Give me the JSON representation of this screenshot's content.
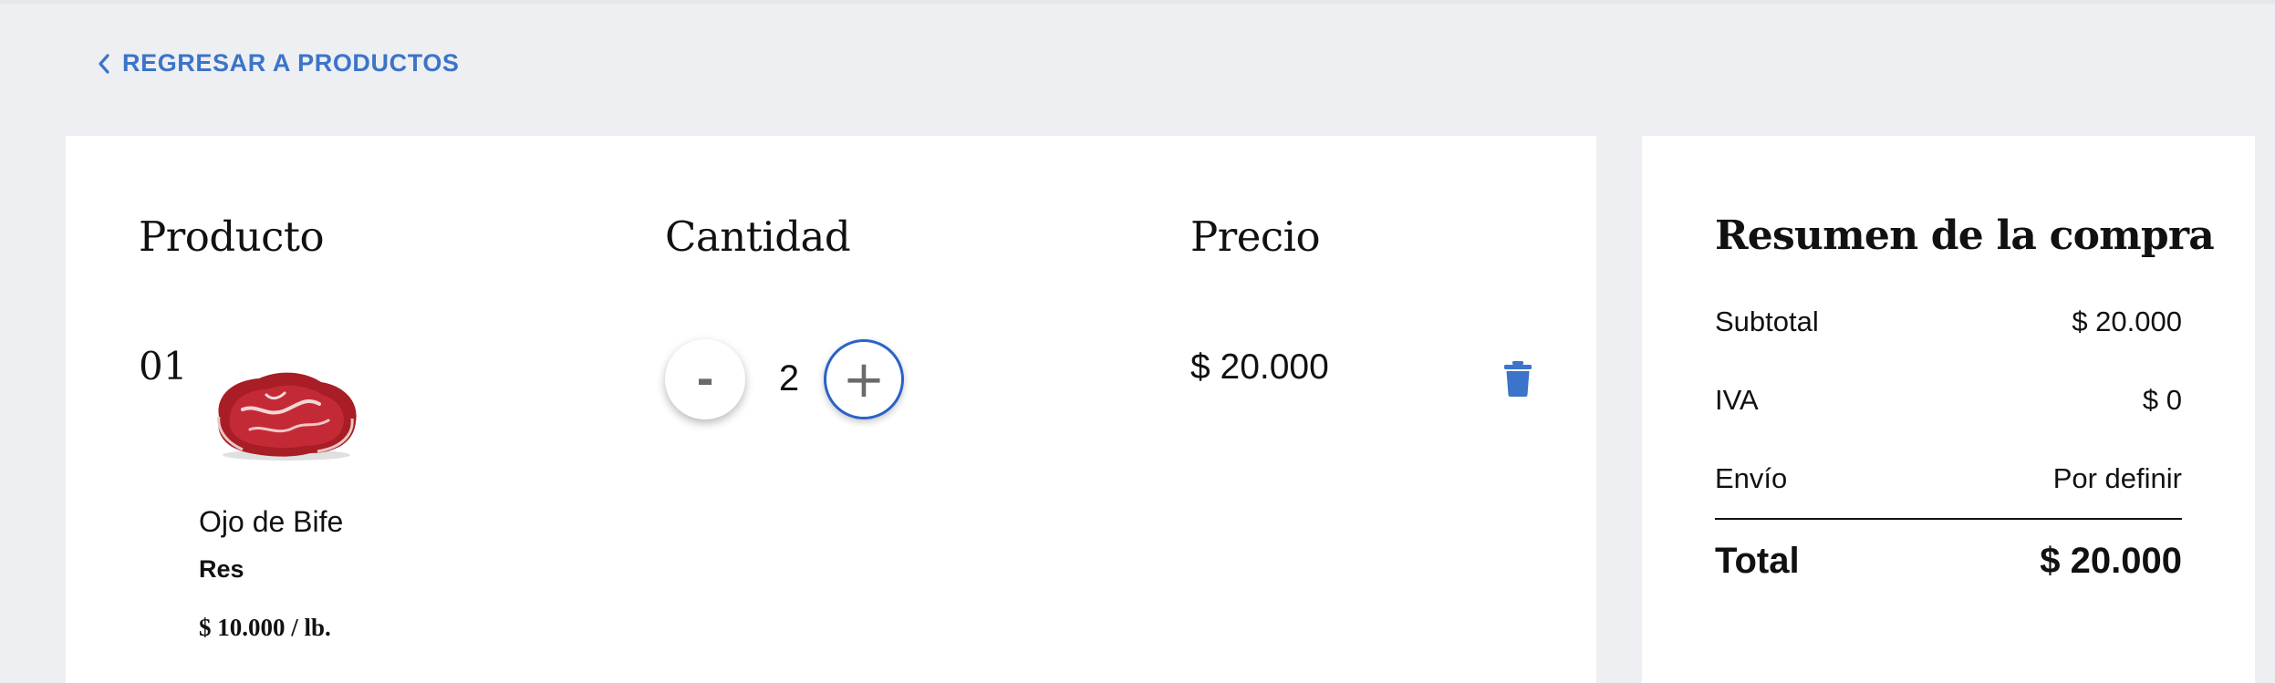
{
  "nav": {
    "back_label": "REGRESAR A PRODUCTOS",
    "back_icon": "chevron-left-icon"
  },
  "cart": {
    "headers": {
      "product": "Producto",
      "quantity": "Cantidad",
      "price": "Precio"
    },
    "items": [
      {
        "index": "01",
        "image": "beef-steak-image",
        "name": "Ojo de Bife",
        "category": "Res",
        "unit_price": "$ 10.000 / lb.",
        "quantity": "2",
        "decrement_label": "-",
        "increment_label": "+",
        "price": "$ 20.000",
        "delete_icon": "trash-icon"
      }
    ]
  },
  "summary": {
    "title": "Resumen de la compra",
    "rows": [
      {
        "label": "Subtotal",
        "value": "$ 20.000"
      },
      {
        "label": "IVA",
        "value": "$ 0"
      },
      {
        "label": "Envío",
        "value": "Por definir"
      }
    ],
    "total": {
      "label": "Total",
      "value": "$ 20.000"
    }
  },
  "colors": {
    "accent": "#3b74c9",
    "plus_border": "#2a62c9",
    "background": "#eeeff2",
    "panel": "#ffffff"
  }
}
